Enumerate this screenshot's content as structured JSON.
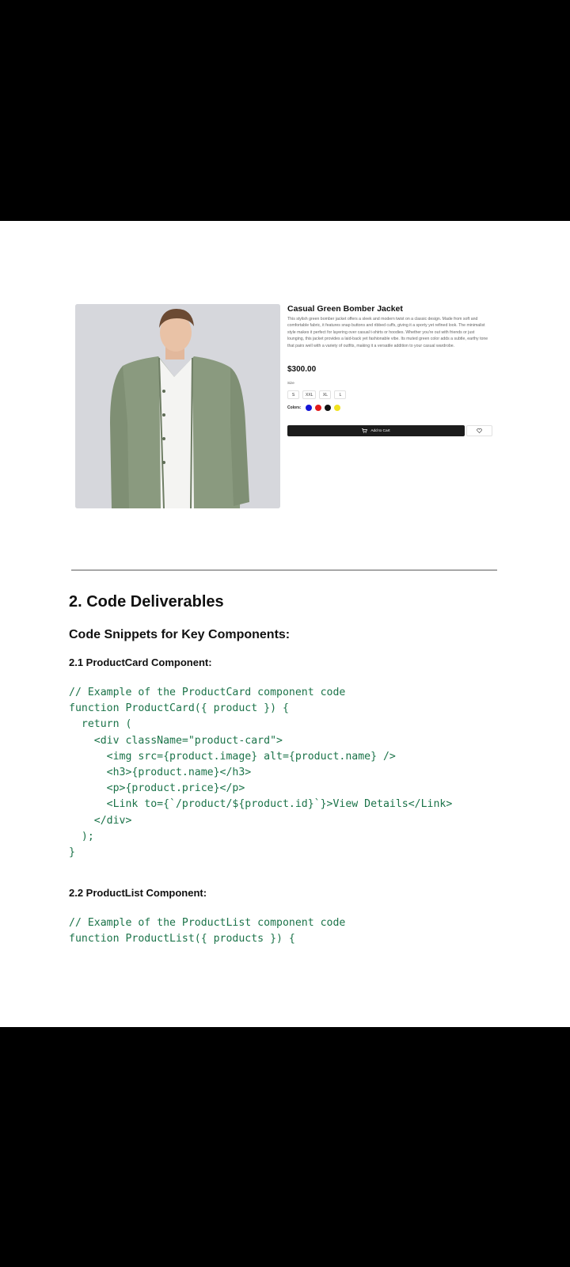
{
  "product": {
    "title": "Casual Green Bomber Jacket",
    "description": "This stylish green bomber jacket offers a sleek and modern twist on a classic design. Made from soft and comfortable fabric, it features snap buttons and ribbed cuffs, giving it a sporty yet refined look. The minimalist style makes it perfect for layering over casual t-shirts or hoodies. Whether you're out with friends or just lounging, this jacket provides a laid-back yet fashionable vibe. Its muted green color adds a subtle, earthy tone that pairs well with a variety of outfits, making it a versatile addition to your casual wardrobe.",
    "price": "$300.00",
    "size_label": "Size",
    "sizes": [
      "S",
      "XXL",
      "XL",
      "L"
    ],
    "colors_label": "Colors:",
    "colors": [
      "#1414d6",
      "#e21b1b",
      "#111111",
      "#f1e21f"
    ],
    "cart_label": "Add to Cart",
    "cart_icon": "cart-icon",
    "fav_icon": "heart-icon",
    "jacket_color": "#8a9a7f",
    "image_bg": "#d6d7dc"
  },
  "section": {
    "title": "2. Code Deliverables",
    "subtitle": "Code Snippets for Key Components:",
    "card_heading": "2.1 ProductCard Component:",
    "card_code": "// Example of the ProductCard component code\nfunction ProductCard({ product }) {\n  return (\n    <div className=\"product-card\">\n      <img src={product.image} alt={product.name} />\n      <h3>{product.name}</h3>\n      <p>{product.price}</p>\n      <Link to={`/product/${product.id}`}>View Details</Link>\n    </div>\n  );\n}",
    "list_heading": "2.2 ProductList Component:",
    "list_code": "// Example of the ProductList component code\nfunction ProductList({ products }) {"
  }
}
